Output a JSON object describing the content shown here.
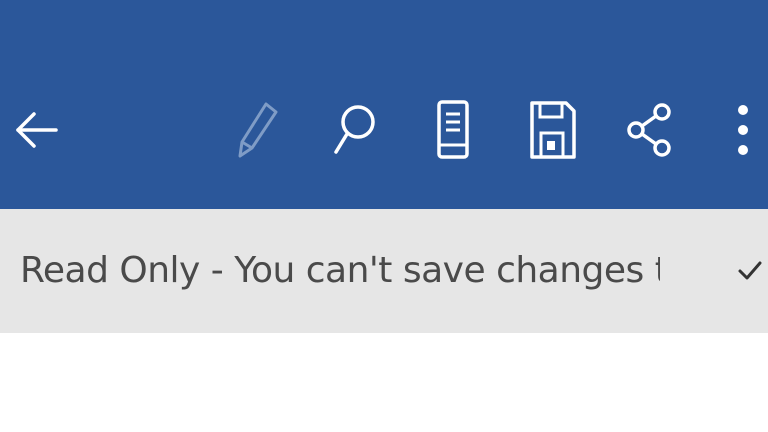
{
  "toolbar": {
    "background": "#2b579a",
    "icon_color": "#ffffff",
    "disabled_icon_color": "#7f9cc6",
    "buttons": [
      {
        "icon": "back-arrow-icon",
        "enabled": true
      },
      {
        "icon": "pencil-icon",
        "enabled": false
      },
      {
        "icon": "search-icon",
        "enabled": true
      },
      {
        "icon": "mobile-view-icon",
        "enabled": true
      },
      {
        "icon": "save-icon",
        "enabled": true
      },
      {
        "icon": "share-icon",
        "enabled": true
      },
      {
        "icon": "more-options-icon",
        "enabled": true
      }
    ]
  },
  "banner": {
    "background": "#e6e6e6",
    "text": "Read Only - You can't save changes to t...",
    "dismiss_icon": "checkmark-icon"
  }
}
